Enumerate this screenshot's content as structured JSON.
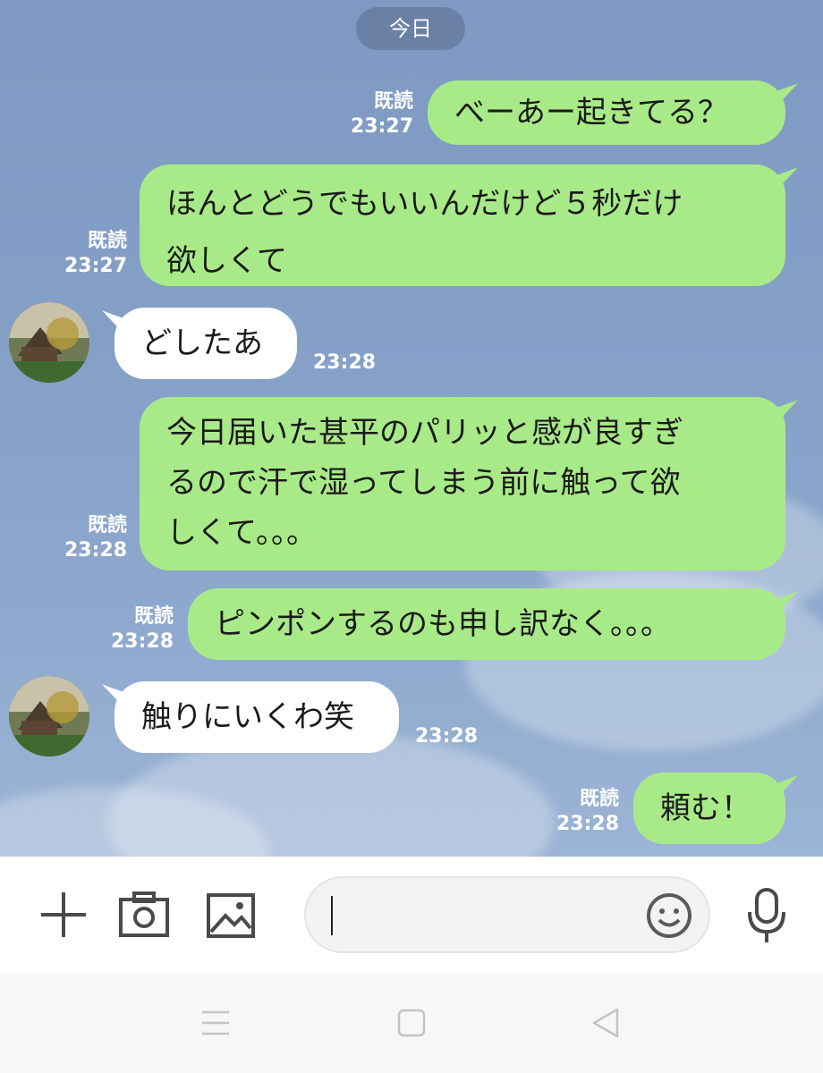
{
  "date_label": "今日",
  "messages": [
    {
      "id": "m1",
      "side": "me",
      "text": "べーあー起きてる？",
      "read": "既読",
      "time": "23:27"
    },
    {
      "id": "m2",
      "side": "me",
      "lines": [
        "ほんとどうでもいいんだけど５秒だけ",
        "欲しくて"
      ],
      "read": "既読",
      "time": "23:27"
    },
    {
      "id": "m3",
      "side": "other",
      "text": "どしたあ",
      "time": "23:28"
    },
    {
      "id": "m4",
      "side": "me",
      "lines": [
        "今日届いた甚平のパリッと感が良すぎ",
        "るので汗で湿ってしまう前に触って欲",
        "しくて。。。"
      ],
      "read": "既読",
      "time": "23:28"
    },
    {
      "id": "m5",
      "side": "me",
      "text": "ピンポンするのも申し訳なく。。。",
      "read": "既読",
      "time": "23:28"
    },
    {
      "id": "m6",
      "side": "other",
      "text": "触りにいくわ笑",
      "time": "23:28"
    },
    {
      "id": "m7",
      "side": "me",
      "text": "頼む！",
      "read": "既読",
      "time": "23:28"
    }
  ],
  "input": {
    "value": "",
    "placeholder": ""
  },
  "toolbar": {
    "icons": [
      "plus-icon",
      "camera-icon",
      "image-icon",
      "emoji-icon",
      "microphone-icon"
    ]
  },
  "navbar": {
    "icons": [
      "menu-icon",
      "home-icon",
      "back-icon"
    ]
  },
  "colors": {
    "my_bubble": "#a9ea88",
    "other_bubble": "#ffffff",
    "chat_bg": "#86a1c8"
  }
}
